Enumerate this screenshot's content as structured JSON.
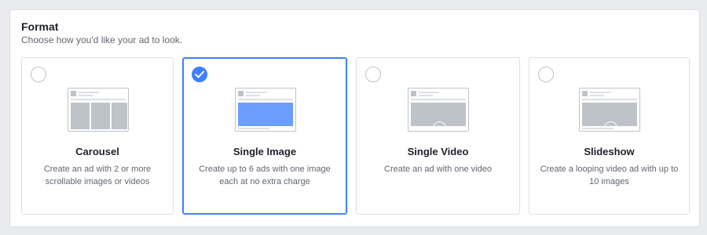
{
  "section": {
    "title": "Format",
    "subtitle": "Choose how you'd like your ad to look."
  },
  "colors": {
    "accent": "#4080ff",
    "thumb_gray": "#bec3c9",
    "text_primary": "#1d2129",
    "text_secondary": "#606770"
  },
  "options": [
    {
      "label": "Carousel",
      "description": "Create an ad with 2 or more scrollable images or videos",
      "selected": false,
      "icon": "carousel-preview-icon"
    },
    {
      "label": "Single Image",
      "description": "Create up to 6 ads with one image each at no extra charge",
      "selected": true,
      "icon": "single-image-preview-icon"
    },
    {
      "label": "Single Video",
      "description": "Create an ad with one video",
      "selected": false,
      "icon": "single-video-preview-icon"
    },
    {
      "label": "Slideshow",
      "description": "Create a looping video ad with up to 10 images",
      "selected": false,
      "icon": "slideshow-preview-icon"
    }
  ]
}
